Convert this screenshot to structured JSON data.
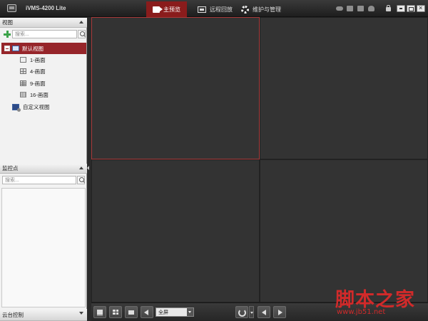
{
  "app": {
    "title": "iVMS-4200 Lite"
  },
  "nav": {
    "tabs": [
      {
        "label": "主预览",
        "icon": "camera-icon",
        "active": true
      },
      {
        "label": "远程回放",
        "icon": "playback-icon",
        "active": false
      },
      {
        "label": "维护与管理",
        "icon": "gear-icon",
        "active": false
      }
    ],
    "right_icons": [
      "cloud-icon",
      "list-icon",
      "image-icon",
      "user-icon",
      "lock-icon"
    ],
    "window_buttons": [
      "minimize",
      "maximize",
      "close"
    ]
  },
  "left_panel": {
    "views_section": {
      "title": "视图",
      "search_placeholder": "搜索...",
      "tree": [
        {
          "label": "默认视图",
          "selected": true,
          "icon": "view-icon"
        },
        {
          "label": "1-画面",
          "icon": "grid-1-icon"
        },
        {
          "label": "4-画面",
          "icon": "grid-4-icon"
        },
        {
          "label": "9-画面",
          "icon": "grid-9-icon"
        },
        {
          "label": "16-画面",
          "icon": "grid-16-icon"
        },
        {
          "label": "自定义视图",
          "icon": "custom-view-icon"
        }
      ]
    },
    "monitor_section": {
      "title": "监控点",
      "search_placeholder": "搜索..."
    },
    "ptz_section": {
      "title": "云台控制"
    }
  },
  "video": {
    "layout": "2x2",
    "selected_cell": 1
  },
  "toolbar": {
    "fullscreen_select": {
      "value": "全屏"
    }
  },
  "watermark": {
    "main": "脚本之家",
    "url": "www.jb51.net"
  },
  "colors": {
    "accent": "#8a1c1c",
    "selected_row": "#96252a",
    "titlebar": "#2a2a2a",
    "video_bg": "#333333"
  }
}
